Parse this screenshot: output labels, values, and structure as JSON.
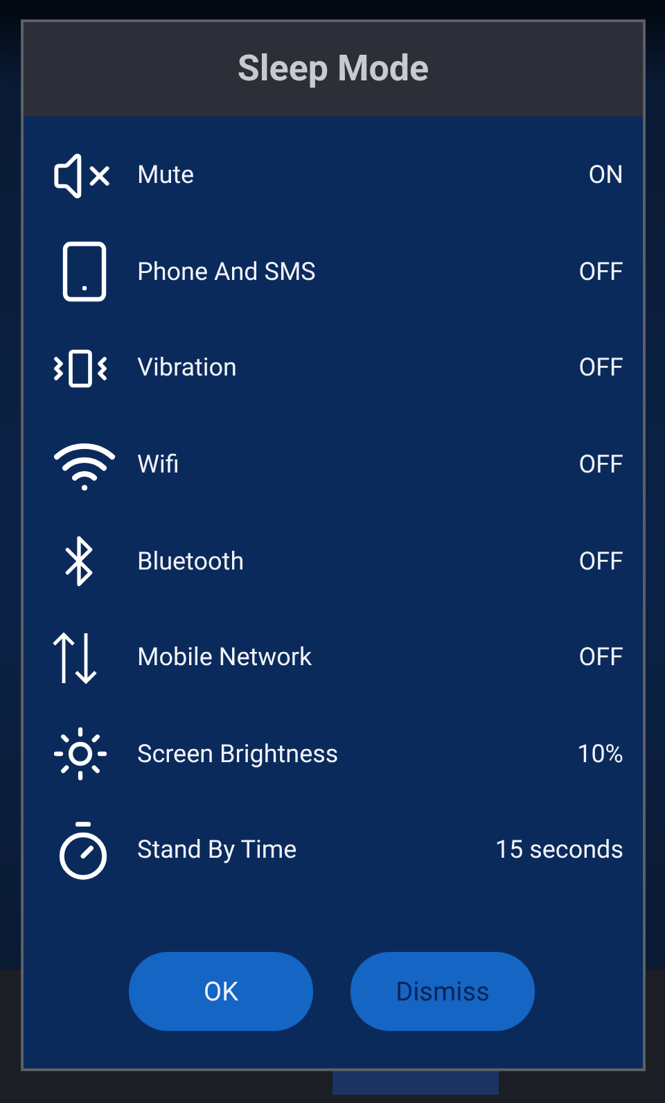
{
  "dialog": {
    "title": "Sleep Mode",
    "settings": [
      {
        "label": "Mute",
        "value": "ON"
      },
      {
        "label": "Phone And SMS",
        "value": "OFF"
      },
      {
        "label": "Vibration",
        "value": "OFF"
      },
      {
        "label": "Wifi",
        "value": "OFF"
      },
      {
        "label": "Bluetooth",
        "value": "OFF"
      },
      {
        "label": "Mobile Network",
        "value": "OFF"
      },
      {
        "label": "Screen Brightness",
        "value": "10%"
      },
      {
        "label": "Stand By Time",
        "value": "15 seconds"
      }
    ],
    "buttons": [
      {
        "label": "OK",
        "kind": "confirm"
      },
      {
        "label": "Dismiss",
        "kind": "dismiss"
      }
    ]
  },
  "tabs": [
    {
      "selected": false
    },
    {
      "selected": false
    },
    {
      "selected": true
    },
    {
      "selected": false
    }
  ]
}
